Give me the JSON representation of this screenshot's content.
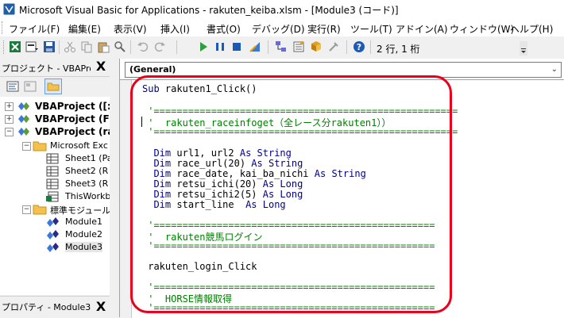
{
  "window": {
    "title": "Microsoft Visual Basic for Applications - rakuten_keiba.xlsm - [Module3 (コード)]"
  },
  "menu": [
    "ファイル(F)",
    "編集(E)",
    "表示(V)",
    "挿入(I)",
    "書式(O)",
    "デバッグ(D)",
    "実行(R)",
    "ツール(T)",
    "アドイン(A)",
    "ウィンドウ(W)",
    "ヘルプ(H)"
  ],
  "toolbar": {
    "position": "2 行, 1 桁"
  },
  "project_panel": {
    "title": "プロジェクト - VBAProject",
    "close": "X",
    "tree": [
      {
        "label": "VBAProject ([:",
        "toggle": "+",
        "bold": true
      },
      {
        "label": "VBAProject (F",
        "toggle": "+",
        "bold": true
      },
      {
        "label": "VBAProject (ra",
        "toggle": "−",
        "bold": true
      },
      {
        "label": "Microsoft Exc",
        "toggle": "−",
        "bold": false
      },
      {
        "label": "Sheet1 (Pa",
        "toggle": "",
        "bold": false
      },
      {
        "label": "Sheet2 (R",
        "toggle": "",
        "bold": false
      },
      {
        "label": "Sheet3 (R",
        "toggle": "",
        "bold": false
      },
      {
        "label": "ThisWorkb",
        "toggle": "",
        "bold": false
      },
      {
        "label": "標準モジュール",
        "toggle": "−",
        "bold": false
      },
      {
        "label": "Module1",
        "toggle": "",
        "bold": false
      },
      {
        "label": "Module2",
        "toggle": "",
        "bold": false
      },
      {
        "label": "Module3",
        "toggle": "",
        "bold": false
      }
    ]
  },
  "properties_panel": {
    "title": "プロパティ - Module3",
    "close": "X"
  },
  "code_window": {
    "object_combo": "(General)",
    "lines": [
      "Sub rakuten1_Click()",
      "",
      " '=====================================================",
      " '  rakuten_raceinfoget（全レース分rakuten1））",
      " '=====================================================",
      "",
      "  Dim url1, url2 As String",
      "  Dim race_url(20) As String",
      "  Dim race_date, kai_ba_nichi As String",
      "  Dim retsu_ichi(20) As Long",
      "  Dim retsu_ichi2(5) As Long",
      "  Dim start_line  As Long",
      "",
      " '=================================================",
      " '  rakuten競馬ログイン",
      " '=================================================",
      "",
      " rakuten_login_Click",
      "",
      " '=================================================",
      " '  HORSE情報取得",
      " '================================================="
    ]
  },
  "colors": {
    "keyword": "#00008b",
    "comment": "#008000",
    "highlight": "#e8001c"
  }
}
